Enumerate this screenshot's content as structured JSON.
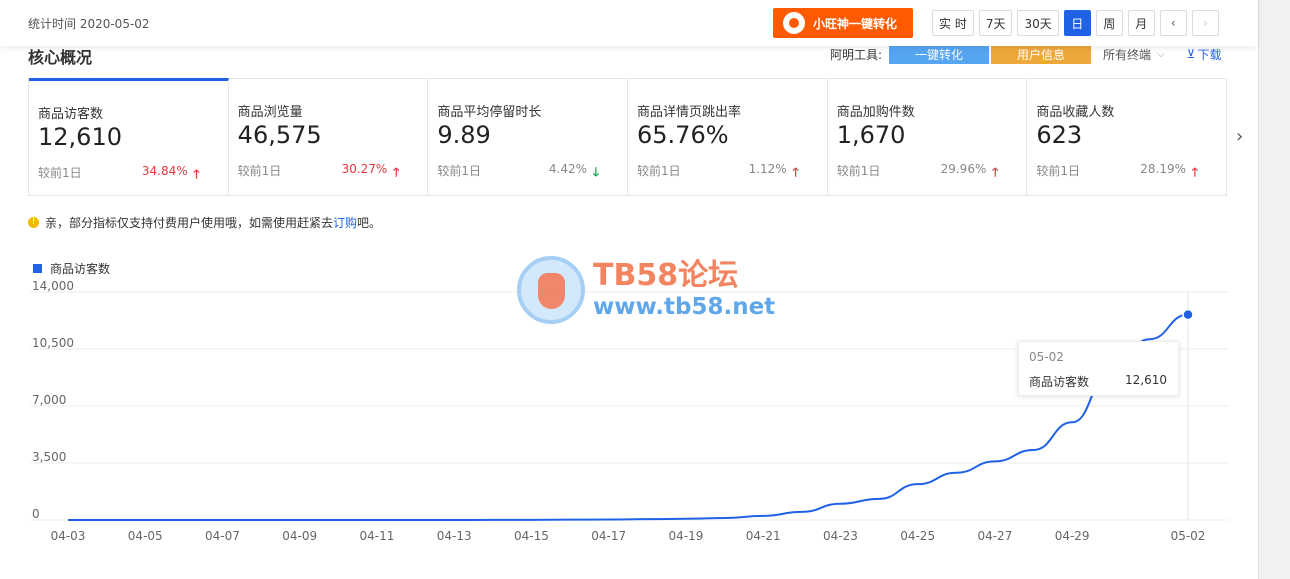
{
  "header": {
    "stat_time": "统计时间 2020-05-02",
    "convert_button": "小旺神一键转化",
    "periods": [
      "实 时",
      "7天",
      "30天",
      "日",
      "周",
      "月"
    ],
    "active_period": "日",
    "prev": "‹",
    "next": "›"
  },
  "section": {
    "title": "核心概况",
    "tools_label": "阿明工具:",
    "tool_convert": "一键转化",
    "tool_userinfo": "用户信息",
    "terminal": "所有终端",
    "download": "下载"
  },
  "cards": [
    {
      "label": "商品访客数",
      "value": "12,610",
      "compare": "较前1日",
      "rate": "34.84%",
      "trend": "up"
    },
    {
      "label": "商品浏览量",
      "value": "46,575",
      "compare": "较前1日",
      "rate": "30.27%",
      "trend": "up"
    },
    {
      "label": "商品平均停留时长",
      "value": "9.89",
      "compare": "较前1日",
      "rate": "4.42%",
      "trend": "down"
    },
    {
      "label": "商品详情页跳出率",
      "value": "65.76%",
      "compare": "较前1日",
      "rate": "1.12%",
      "trend": "up"
    },
    {
      "label": "商品加购件数",
      "value": "1,670",
      "compare": "较前1日",
      "rate": "29.96%",
      "trend": "up"
    },
    {
      "label": "商品收藏人数",
      "value": "623",
      "compare": "较前1日",
      "rate": "28.19%",
      "trend": "up"
    }
  ],
  "notice": {
    "text": "亲，部分指标仅支持付费用户使用哦，如需使用赶紧去",
    "link": "订购",
    "suffix": "吧。"
  },
  "watermark": {
    "title": "TB58论坛",
    "url": "www.tb58.net"
  },
  "tooltip": {
    "date": "05-02",
    "name": "商品访客数",
    "value": "12,610"
  },
  "chart_data": {
    "type": "line",
    "y_ticks": [
      "14,000",
      "10,500",
      "7,000",
      "3,500",
      "0"
    ],
    "ylim": [
      0,
      14000
    ],
    "x_tick_labels": [
      "04-03",
      "04-05",
      "04-07",
      "04-09",
      "04-11",
      "04-13",
      "04-15",
      "04-17",
      "04-19",
      "04-21",
      "04-23",
      "04-25",
      "04-27",
      "04-29",
      "05-02"
    ],
    "x": [
      "04-03",
      "04-04",
      "04-05",
      "04-06",
      "04-07",
      "04-08",
      "04-09",
      "04-10",
      "04-11",
      "04-12",
      "04-13",
      "04-14",
      "04-15",
      "04-16",
      "04-17",
      "04-18",
      "04-19",
      "04-20",
      "04-21",
      "04-22",
      "04-23",
      "04-24",
      "04-25",
      "04-26",
      "04-27",
      "04-28",
      "04-29",
      "04-30",
      "05-01",
      "05-02"
    ],
    "series": [
      {
        "name": "商品访客数",
        "color": "#2062e6",
        "values": [
          0,
          0,
          0,
          0,
          0,
          0,
          0,
          0,
          0,
          0,
          0,
          5,
          10,
          20,
          30,
          50,
          80,
          120,
          250,
          500,
          1000,
          1300,
          2200,
          2900,
          3600,
          4300,
          6000,
          9100,
          11100,
          12610
        ]
      }
    ],
    "legend": "top-left",
    "grid": true
  }
}
